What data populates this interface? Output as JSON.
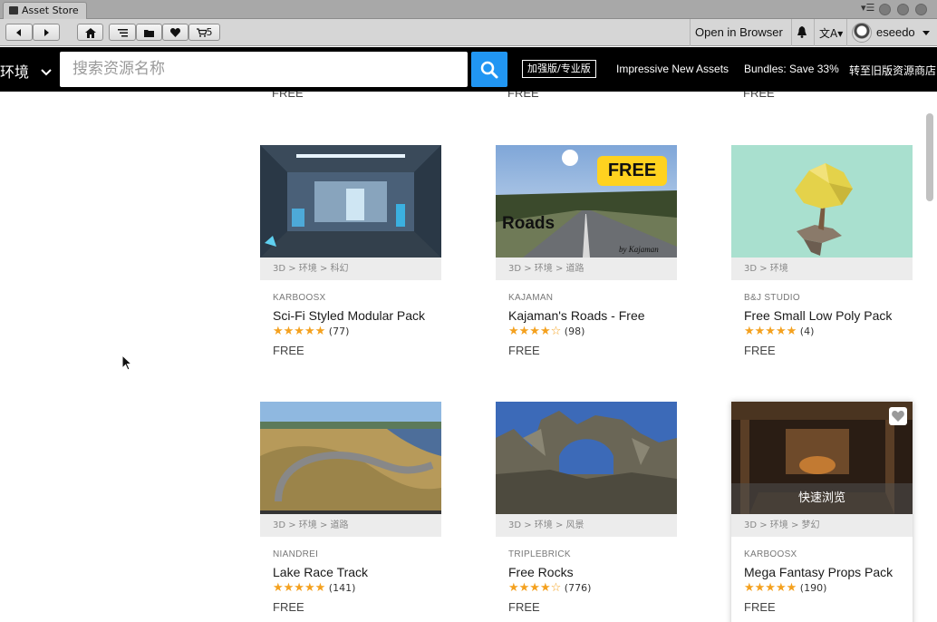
{
  "window": {
    "tab_title": "Asset Store"
  },
  "toolbar": {
    "cart_count": "5",
    "open_in_browser": "Open in Browser",
    "user_name": "eseedo"
  },
  "store_header": {
    "category": "环境",
    "search_placeholder": "搜索资源名称",
    "plus_pro": "加强版/专业版",
    "links": [
      "Impressive New Assets",
      "Bundles: Save 33%",
      "转至旧版资源商店"
    ]
  },
  "top_row_prices": [
    "FREE",
    "FREE",
    "FREE"
  ],
  "assets": [
    {
      "breadcrumb": "3D > 环境 > 科幻",
      "publisher": "KARBOOSX",
      "title": "Sci-Fi Styled Modular Pack",
      "stars": "★★★★★",
      "reviews": "(77)",
      "price": "FREE"
    },
    {
      "breadcrumb": "3D > 环境 > 道路",
      "publisher": "KAJAMAN",
      "title": "Kajaman's Roads - Free",
      "stars": "★★★★☆",
      "reviews": "(98)",
      "price": "FREE",
      "image_badge": "FREE",
      "image_caption": "Roads",
      "image_signature": "by Kajaman"
    },
    {
      "breadcrumb": "3D > 环境",
      "publisher": "B&J STUDIO",
      "title": "Free Small Low Poly Pack",
      "stars": "★★★★★",
      "reviews": "(4)",
      "price": "FREE"
    },
    {
      "breadcrumb": "3D > 环境 > 道路",
      "publisher": "NIANDREI",
      "title": "Lake Race Track",
      "stars": "★★★★★",
      "reviews": "(141)",
      "price": "FREE"
    },
    {
      "breadcrumb": "3D > 环境 > 风景",
      "publisher": "TRIPLEBRICK",
      "title": "Free Rocks",
      "stars": "★★★★☆",
      "reviews": "(776)",
      "price": "FREE"
    },
    {
      "breadcrumb": "3D > 环境 > 梦幻",
      "publisher": "KARBOOSX",
      "title": "Mega Fantasy Props Pack",
      "stars": "★★★★★",
      "reviews": "(190)",
      "price": "FREE",
      "quick_view": "快速浏览"
    }
  ],
  "colors": {
    "accent": "#2196f3",
    "star": "#f4a11f",
    "header_bg": "#000000"
  }
}
